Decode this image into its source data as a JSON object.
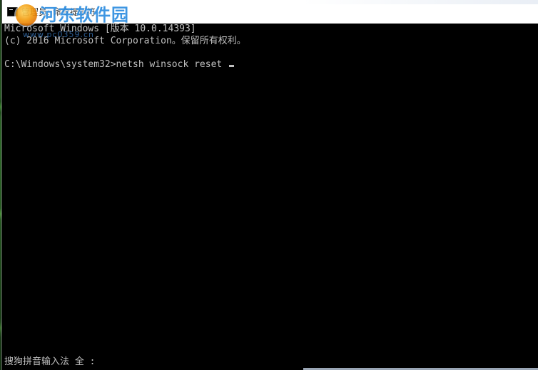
{
  "window": {
    "title": "管理员: 命令提示符"
  },
  "watermark": {
    "text": "河东软件园",
    "subtext": "www.pc0359.cn"
  },
  "console": {
    "lines": [
      "Microsoft Windows [版本 10.0.14393]",
      "(c) 2016 Microsoft Corporation。保留所有权利。",
      "C:\\Windows\\system32>netsh winsock reset "
    ]
  },
  "ime": {
    "status": "搜狗拼音输入法 全 :"
  },
  "colors": {
    "console_bg": "#000000",
    "console_fg": "#c0c0c0",
    "titlebar_bg": "#ffffff",
    "watermark": "#2e8ee0"
  }
}
